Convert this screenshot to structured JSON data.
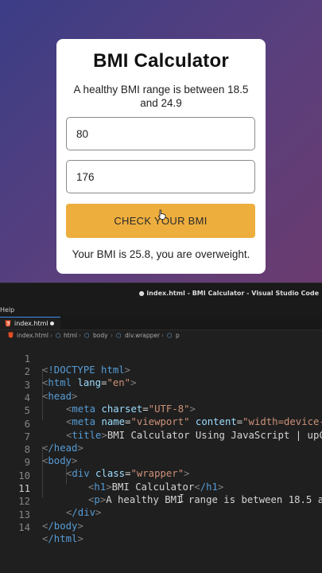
{
  "app": {
    "heading": "BMI Calculator",
    "subtitle": "A healthy BMI range is between 18.5 and 24.9",
    "weight_value": "80",
    "height_value": "176",
    "button_label": "CHECK YOUR BMI",
    "result_text": "Your BMI is 25.8, you are overweight."
  },
  "vscode": {
    "window_title": "● index.html - BMI Calculator - Visual Studio Code",
    "menu_help": "Help",
    "tab_label": "index.html",
    "breadcrumbs": [
      "index.html",
      "html",
      "body",
      "div.wrapper",
      "p"
    ],
    "active_line": 11,
    "lines": [
      {
        "n": "1"
      },
      {
        "n": "2"
      },
      {
        "n": "3"
      },
      {
        "n": "4"
      },
      {
        "n": "5"
      },
      {
        "n": "6"
      },
      {
        "n": "7"
      },
      {
        "n": "8"
      },
      {
        "n": "9"
      },
      {
        "n": "10"
      },
      {
        "n": "11"
      },
      {
        "n": "12"
      },
      {
        "n": "13"
      },
      {
        "n": "14"
      }
    ],
    "code": {
      "l1_doctype": "!DOCTYPE html",
      "l2_tag": "html",
      "l2_attr": "lang",
      "l2_val": "\"en\"",
      "l3_tag": "head",
      "l4_tag": "meta",
      "l4_attr": "charset",
      "l4_val": "\"UTF-8\"",
      "l5_tag": "meta",
      "l5_attr1": "name",
      "l5_val1": "\"viewport\"",
      "l5_attr2": "content",
      "l5_val2": "\"width=device-w",
      "l6_tag": "title",
      "l6_text": "BMI Calculator Using JavaScript | upCo",
      "l7_tag": "/head",
      "l8_tag": "body",
      "l9_tag": "div",
      "l9_attr": "class",
      "l9_val": "\"wrapper\"",
      "l10_tag": "h1",
      "l10_text": "BMI Calculator",
      "l10_close": "/h1",
      "l11_tag": "p",
      "l11_text": "A healthy BMI range is between 18.5 a",
      "l12_tag": "/div",
      "l13_tag": "/body",
      "l14_tag": "/html"
    }
  }
}
